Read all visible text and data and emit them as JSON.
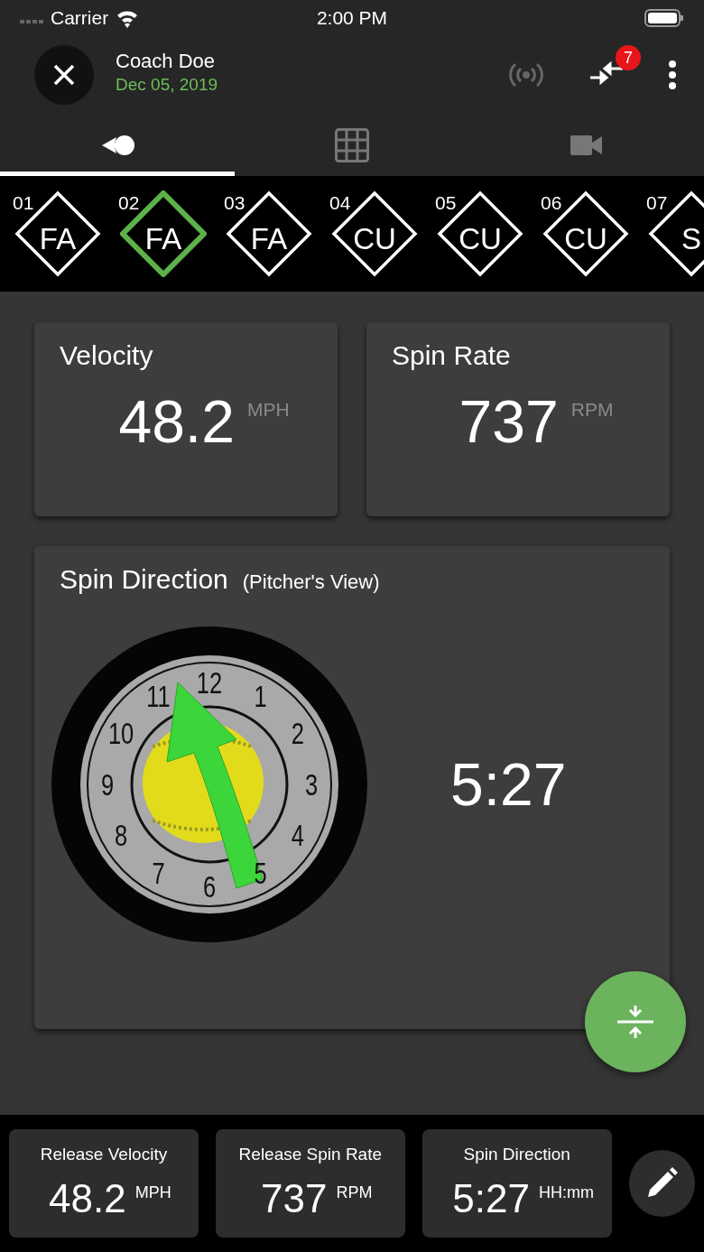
{
  "status_bar": {
    "carrier": "Carrier",
    "time": "2:00 PM"
  },
  "header": {
    "title": "Coach Doe",
    "date": "Dec 05, 2019",
    "badge": "7"
  },
  "tabs": [
    {
      "kind": "pitch",
      "selected": true
    },
    {
      "kind": "grid",
      "selected": false
    },
    {
      "kind": "video",
      "selected": false
    }
  ],
  "pitches": [
    {
      "number": "01",
      "type": "FA",
      "selected": false
    },
    {
      "number": "02",
      "type": "FA",
      "selected": true
    },
    {
      "number": "03",
      "type": "FA",
      "selected": false
    },
    {
      "number": "04",
      "type": "CU",
      "selected": false
    },
    {
      "number": "05",
      "type": "CU",
      "selected": false
    },
    {
      "number": "06",
      "type": "CU",
      "selected": false
    },
    {
      "number": "07",
      "type": "S",
      "selected": false
    }
  ],
  "metrics": [
    {
      "title": "Velocity",
      "value": "48.2",
      "unit": "MPH"
    },
    {
      "title": "Spin Rate",
      "value": "737",
      "unit": "RPM"
    }
  ],
  "spin_direction": {
    "title": "Spin Direction",
    "subtitle": "(Pitcher's View)",
    "value": "5:27",
    "clock_numbers": [
      "12",
      "1",
      "2",
      "3",
      "4",
      "5",
      "6",
      "7",
      "8",
      "9",
      "10",
      "11"
    ]
  },
  "release": [
    {
      "label": "Release Velocity",
      "value": "48.2",
      "unit": "MPH"
    },
    {
      "label": "Release Spin Rate",
      "value": "737",
      "unit": "RPM"
    },
    {
      "label": "Spin Direction",
      "value": "5:27",
      "unit": "HH:mm"
    }
  ]
}
